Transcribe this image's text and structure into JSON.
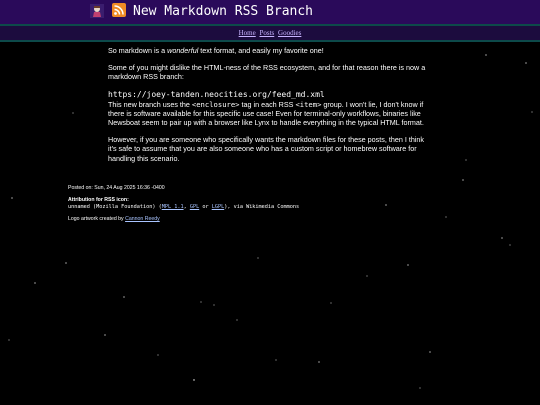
{
  "header": {
    "title": "New Markdown RSS Branch",
    "logo_icon": "site-logo-icon",
    "rss_icon": "rss-icon"
  },
  "nav": {
    "items": [
      {
        "label": "Home"
      },
      {
        "label": "Posts"
      },
      {
        "label": "Goodies"
      }
    ]
  },
  "article": {
    "p1_before": "So markdown is a ",
    "p1_em": "wonderful",
    "p1_after": " text format, and easily my favorite one!",
    "p2": "Some of you might dislike the HTML-ness of the RSS ecosystem, and for that reason there is now a markdown RSS branch:",
    "feed_url": "https://joey-tanden.neocities.org/feed_md.xml",
    "p3_a": "This new branch uses the ",
    "p3_code1": "<enclosure>",
    "p3_b": " tag in each RSS ",
    "p3_code2": "<item>",
    "p3_c": " group. I won't lie, I don't know if there is software available for this specific use case! Even for terminal-only workflows, binaries like Newsboat seem to pair up with a browser like Lynx to handle everything in the typical HTML format.",
    "p4": "However, if you are someone who specifically wants the markdown files for these posts, then I think it's safe to assume that you are also someone who has a custom script or homebrew software for handling this scenario."
  },
  "meta": {
    "posted": "Posted on: Sun, 24 Aug 2025 16:36 -0400",
    "attr_title": "Attribution for RSS icon:",
    "attr_prefix": "unnamed (Mozilla Foundation) (",
    "license1": "MPL 1.1",
    "sep1": ", ",
    "license2": "GPL",
    "sep2": " or ",
    "license3": "LGPL",
    "attr_suffix": "), via Wikimedia Commons",
    "logo_prefix": "Logo artwork created by ",
    "logo_author": "Cannon Reedy"
  },
  "colors": {
    "header_bg": "#2a0a5a",
    "nav_bg": "#1c0c3e",
    "accent": "#0d4a4a",
    "link": "#c7b4ff",
    "page_bg": "#000000"
  }
}
